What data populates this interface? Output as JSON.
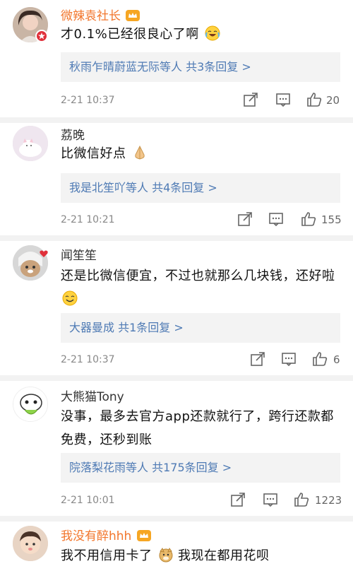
{
  "comments": [
    {
      "username": "微辣袁社长",
      "text": "才0.1%已经很良心了啊",
      "replies": "秋雨乍晴蔚蓝无际等人  共3条回复 >",
      "time": "2-21 10:37",
      "likes": "20"
    },
    {
      "username": "荔晚",
      "text": "比微信好点",
      "replies": "我是北笙吖等人  共4条回复 >",
      "time": "2-21 10:21",
      "likes": "155"
    },
    {
      "username": "闻笙笙",
      "text": "还是比微信便宜，不过也就那么几块钱，还好啦",
      "replies": "大器曼成  共1条回复 >",
      "time": "2-21 10:37",
      "likes": "6"
    },
    {
      "username": "大熊猫Tony",
      "text": "没事，最多去官方app还款就行了，跨行还款都免费，还秒到账",
      "replies": "院落梨花雨等人  共175条回复 >",
      "time": "2-21 10:01",
      "likes": "1223"
    },
    {
      "username": "我没有醉hhh",
      "text_before": "我不用信用卡了",
      "text_after": "我现在都用花呗"
    }
  ],
  "icons": {
    "share": "share-icon",
    "comment": "comment-icon",
    "like": "thumbs-up-icon",
    "crown": "crown-badge-icon",
    "vip": "vip-badge-icon"
  },
  "colors": {
    "username_vip": "#f2762c",
    "reply_link": "#4e7ab4",
    "reply_bg": "#f3f3f3"
  }
}
